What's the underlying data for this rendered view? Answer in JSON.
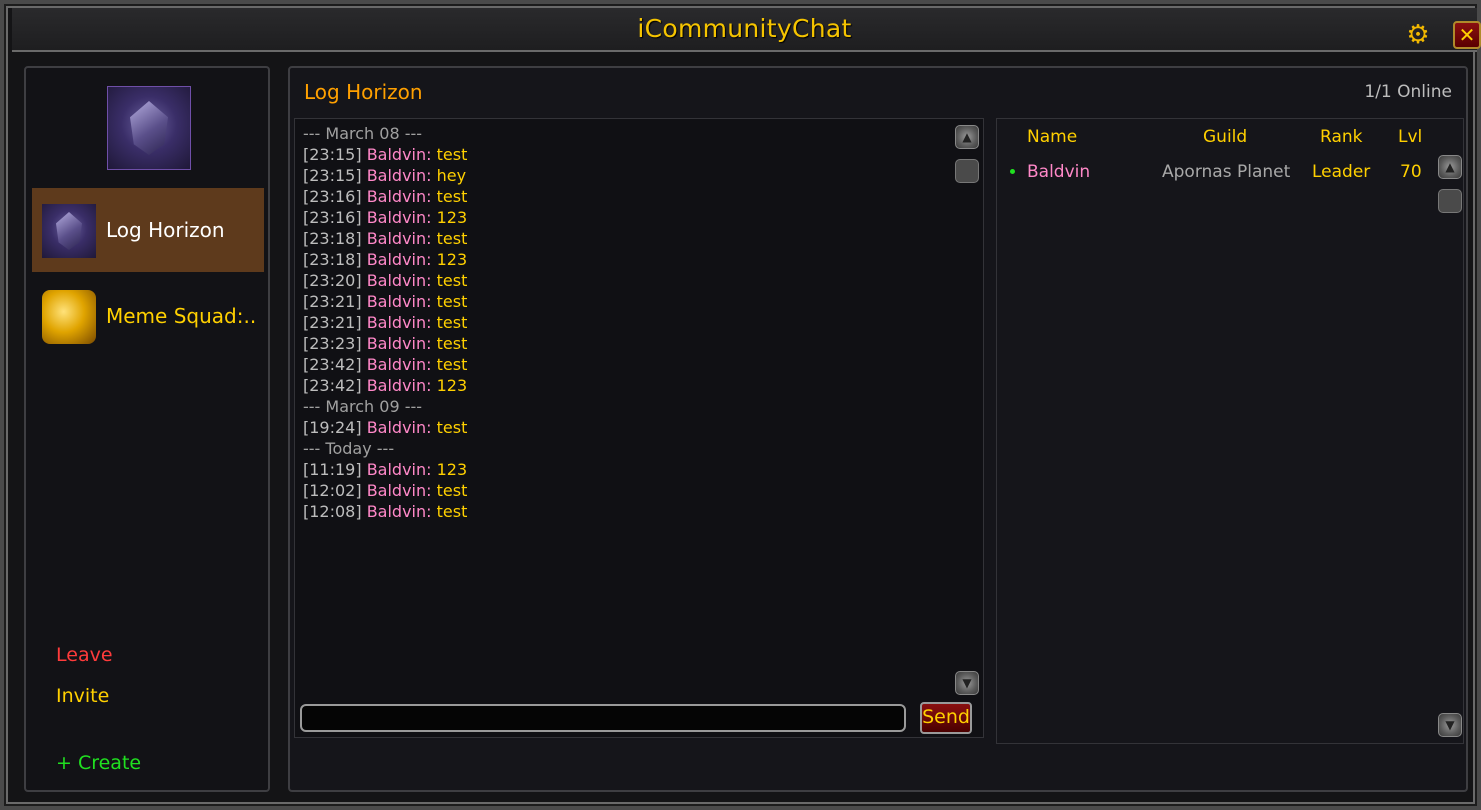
{
  "window": {
    "title": "iCommunityChat",
    "settings_icon": "gear-icon",
    "close_icon": "close-icon",
    "close_glyph": "✕"
  },
  "sidebar": {
    "communities": [
      {
        "label": "Log Horizon",
        "icon": "purple-gem-icon",
        "selected": true
      },
      {
        "label": "Meme Squad:..",
        "icon": "gold-coins-icon",
        "selected": false
      }
    ],
    "actions": {
      "leave": "Leave",
      "invite": "Invite",
      "create": "+ Create"
    }
  },
  "chat": {
    "community_name": "Log Horizon",
    "online_status": "1/1 Online",
    "send_label": "Send",
    "messages": [
      {
        "type": "separator",
        "text": "--- March 08 ---"
      },
      {
        "type": "msg",
        "time": "[23:15]",
        "author": "Baldvin:",
        "text": "test"
      },
      {
        "type": "msg",
        "time": "[23:15]",
        "author": "Baldvin:",
        "text": "hey"
      },
      {
        "type": "msg",
        "time": "[23:16]",
        "author": "Baldvin:",
        "text": "test"
      },
      {
        "type": "msg",
        "time": "[23:16]",
        "author": "Baldvin:",
        "text": "123"
      },
      {
        "type": "msg",
        "time": "[23:18]",
        "author": "Baldvin:",
        "text": "test"
      },
      {
        "type": "msg",
        "time": "[23:18]",
        "author": "Baldvin:",
        "text": "123"
      },
      {
        "type": "msg",
        "time": "[23:20]",
        "author": "Baldvin:",
        "text": "test"
      },
      {
        "type": "msg",
        "time": "[23:21]",
        "author": "Baldvin:",
        "text": "test"
      },
      {
        "type": "msg",
        "time": "[23:21]",
        "author": "Baldvin:",
        "text": "test"
      },
      {
        "type": "msg",
        "time": "[23:23]",
        "author": "Baldvin:",
        "text": "test"
      },
      {
        "type": "msg",
        "time": "[23:42]",
        "author": "Baldvin:",
        "text": "test"
      },
      {
        "type": "msg",
        "time": "[23:42]",
        "author": "Baldvin:",
        "text": "123"
      },
      {
        "type": "separator",
        "text": "--- March 09 ---"
      },
      {
        "type": "msg",
        "time": "[19:24]",
        "author": "Baldvin:",
        "text": "test"
      },
      {
        "type": "separator",
        "text": "--- Today ---"
      },
      {
        "type": "msg",
        "time": "[11:19]",
        "author": "Baldvin:",
        "text": "123"
      },
      {
        "type": "msg",
        "time": "[12:02]",
        "author": "Baldvin:",
        "text": "test"
      },
      {
        "type": "msg",
        "time": "[12:08]",
        "author": "Baldvin:",
        "text": "test"
      }
    ]
  },
  "roster": {
    "headers": {
      "name": "Name",
      "guild": "Guild",
      "rank": "Rank",
      "level": "Lvl"
    },
    "members": [
      {
        "name": "Baldvin",
        "guild": "Apornas Planet",
        "rank": "Leader",
        "level": "70",
        "online": true
      }
    ]
  },
  "colors": {
    "title": "#f5c400",
    "community_title": "#ffa000",
    "author": "#ff88c8",
    "message": "#ffd000",
    "leave": "#ff3b3b",
    "create": "#20e020",
    "selected_bg": "#5e3a1c"
  }
}
